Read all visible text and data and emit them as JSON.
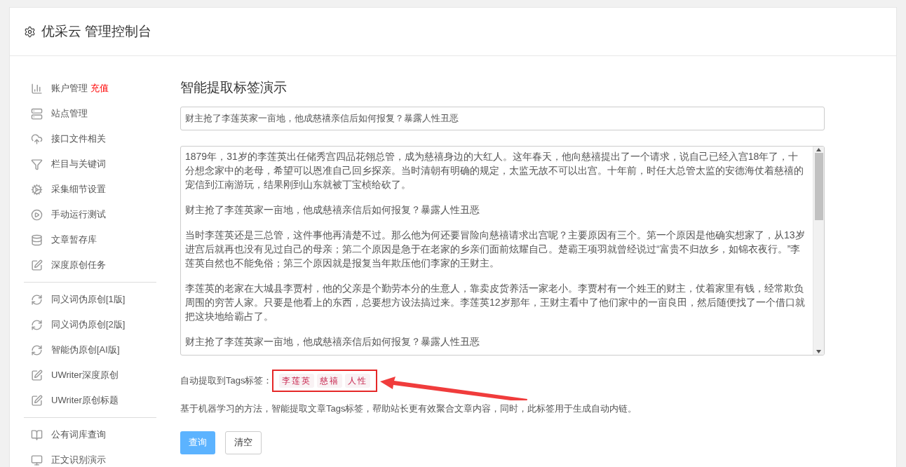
{
  "header": {
    "title": "优采云 管理控制台"
  },
  "sidebar": {
    "groups": [
      {
        "items": [
          {
            "label": "账户管理",
            "badge": "充值"
          },
          {
            "label": "站点管理"
          },
          {
            "label": "接口文件相关"
          },
          {
            "label": "栏目与关键词"
          },
          {
            "label": "采集细节设置"
          },
          {
            "label": "手动运行测试"
          },
          {
            "label": "文章暂存库"
          },
          {
            "label": "深度原创任务"
          }
        ]
      },
      {
        "items": [
          {
            "label": "同义词伪原创[1版]"
          },
          {
            "label": "同义词伪原创[2版]"
          },
          {
            "label": "智能伪原创[AI版]"
          },
          {
            "label": "UWriter深度原创"
          },
          {
            "label": "UWriter原创标题"
          }
        ]
      },
      {
        "items": [
          {
            "label": "公有词库查询"
          },
          {
            "label": "正文识别演示"
          }
        ]
      }
    ]
  },
  "main": {
    "title": "智能提取标签演示",
    "title_field": {
      "value": "财主抢了李莲英家一亩地，他成慈禧亲信后如何报复？暴露人性丑恶"
    },
    "content_field": {
      "paragraphs": [
        "1879年，31岁的李莲英出任储秀宫四品花翎总管，成为慈禧身边的大红人。这年春天，他向慈禧提出了一个请求，说自己已经入宫18年了，十分想念家中的老母，希望可以恩准自己回乡探亲。当时清朝有明确的规定，太监无故不可以出宫。十年前，时任大总管太监的安德海仗着慈禧的宠信到江南游玩，结果刚到山东就被丁宝桢给砍了。",
        "财主抢了李莲英家一亩地，他成慈禧亲信后如何报复？暴露人性丑恶",
        "当时李莲英还是三总管，这件事他再清楚不过。那么他为何还要冒险向慈禧请求出宫呢？主要原因有三个。第一个原因是他确实想家了，从13岁进宫后就再也没有见过自己的母亲；第二个原因是急于在老家的乡亲们面前炫耀自己。楚霸王项羽就曾经说过“富贵不归故乡，如锦衣夜行。”李莲英自然也不能免俗；第三个原因就是报复当年欺压他们李家的王财主。",
        "李莲英的老家在大城县李贾村，他的父亲是个勤劳本分的生意人，靠卖皮货养活一家老小。李贾村有一个姓王的财主，仗着家里有钱，经常欺负周围的穷苦人家。只要是他看上的东西，总要想方设法搞过来。李莲英12岁那年，王财主看中了他们家中的一亩良田，然后随便找了一个借口就把这块地给霸占了。",
        "财主抢了李莲英家一亩地，他成慈禧亲信后如何报复？暴露人性丑恶"
      ]
    },
    "tags_label": "自动提取到Tags标签：",
    "tags": [
      "李莲英",
      "慈禧",
      "人性"
    ],
    "description": "基于机器学习的方法，智能提取文章Tags标签，帮助站长更有效聚合文章内容，同时，此标签用于生成自动内链。",
    "buttons": [
      {
        "label": "查询",
        "kind": "primary"
      },
      {
        "label": "清空",
        "kind": "default"
      }
    ]
  }
}
